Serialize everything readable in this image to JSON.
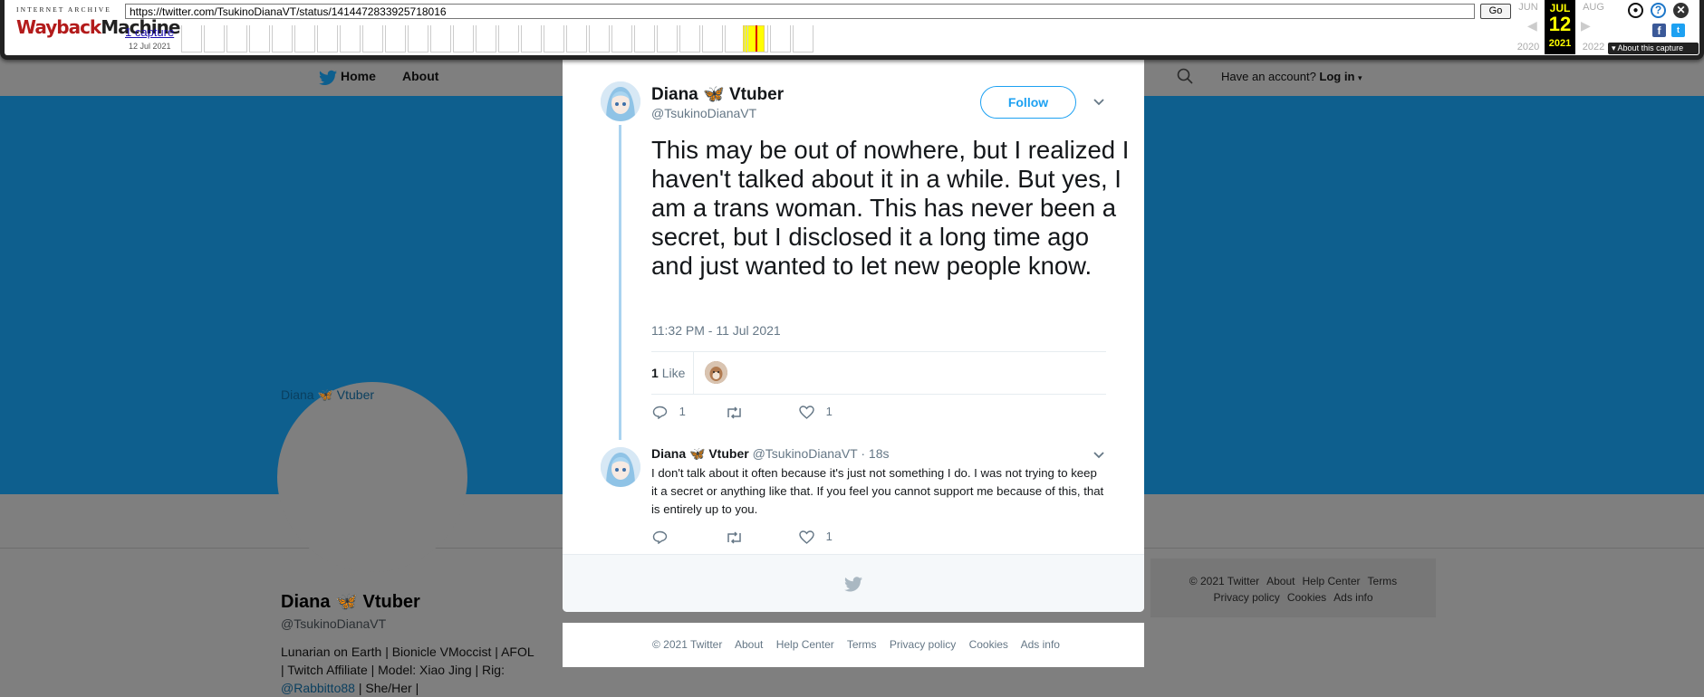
{
  "wayback": {
    "logo_top": "INTERNET ARCHIVE",
    "logo_main_a": "Wayback",
    "logo_main_b": "Machine",
    "url": "https://twitter.com/TsukinoDianaVT/status/1414472833925718016",
    "go_label": "Go",
    "captures_link": "1 capture",
    "captures_date": "12 Jul 2021",
    "prev_month": "JUN",
    "cur_month": "JUL",
    "next_month": "AUG",
    "cur_day": "12",
    "prev_year": "2020",
    "cur_year": "2021",
    "next_year": "2022",
    "about_capture": "About this capture",
    "icons": [
      "user-icon",
      "help-icon",
      "close-icon",
      "facebook-icon",
      "twitter-icon"
    ]
  },
  "twitter_nav": {
    "home": "Home",
    "about": "About",
    "have_account": "Have an account?",
    "login": "Log in"
  },
  "profile": {
    "avatar_alt": "Diana 🦋 Vtuber",
    "name": "Diana 🦋 Vtuber",
    "handle": "@TsukinoDianaVT",
    "bio_line1": "Lunarian on Earth | Bionicle VMoccist | AFOL",
    "bio_line2": "| Twitch Affiliate | Model: Xiao Jing | Rig:",
    "bio_link": "@Rabbitto88",
    "bio_line3_rest": " | She/Her |"
  },
  "side_footer": {
    "copyright": "© 2021 Twitter",
    "about": "About",
    "help": "Help Center",
    "terms": "Terms",
    "privacy": "Privacy policy",
    "cookies": "Cookies",
    "ads": "Ads info"
  },
  "tweet": {
    "author_name": "Diana 🦋 Vtuber",
    "author_handle": "@TsukinoDianaVT",
    "follow_label": "Follow",
    "text": "This may be out of nowhere, but I realized I haven't talked about it in a while. But yes, I am a trans woman. This has never been a secret, but I disclosed it a long time ago and just wanted to let new people know.",
    "timestamp": "11:32 PM - 11 Jul 2021",
    "likes_number": "1",
    "likes_label": "Like",
    "reply_count": "1",
    "like_count": "1"
  },
  "reply": {
    "author_name": "Diana 🦋 Vtuber",
    "author_handle": "@TsukinoDianaVT",
    "time": "· 18s",
    "text": "I don't talk about it often because it's just not something  I do. I was not trying to keep it a secret or anything like that. If you feel you cannot support me because of this, that is entirely up to you.",
    "like_count": "1"
  },
  "page_footer": {
    "copyright": "© 2021 Twitter",
    "about": "About",
    "help": "Help Center",
    "terms": "Terms",
    "privacy": "Privacy policy",
    "cookies": "Cookies",
    "ads": "Ads info"
  }
}
